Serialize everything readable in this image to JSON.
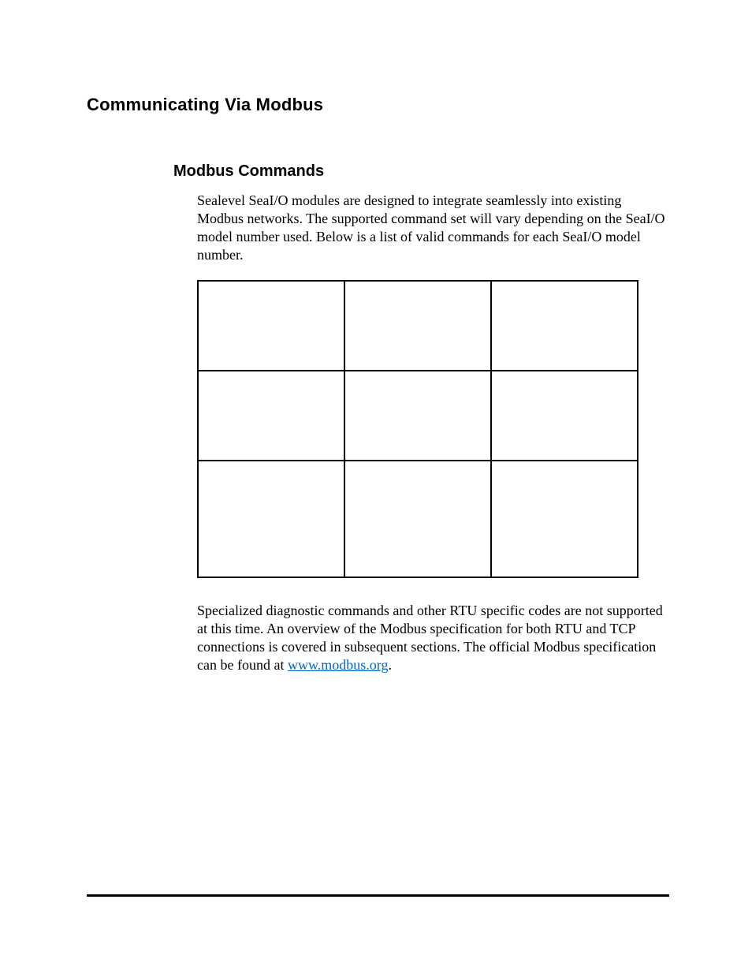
{
  "section_heading": "Communicating Via Modbus",
  "sub_heading": "Modbus Commands",
  "intro_paragraph": "Sealevel SeaI/O modules are designed to integrate seamlessly into existing Modbus networks. The supported command set will vary depending on the SeaI/O model number used. Below is a list of valid commands for each SeaI/O model number.",
  "table": {
    "rows": [
      {
        "cells": [
          "",
          "",
          ""
        ]
      },
      {
        "cells": [
          "",
          "",
          ""
        ]
      },
      {
        "cells": [
          "",
          "",
          ""
        ]
      }
    ]
  },
  "closing_text_before_link": "Specialized diagnostic commands and other RTU specific codes are not supported at this time. An overview of the Modbus specification for both RTU and TCP connections is covered in subsequent sections. The official Modbus specification can be found at ",
  "link_text": "www.modbus.org",
  "closing_text_after_link": "."
}
